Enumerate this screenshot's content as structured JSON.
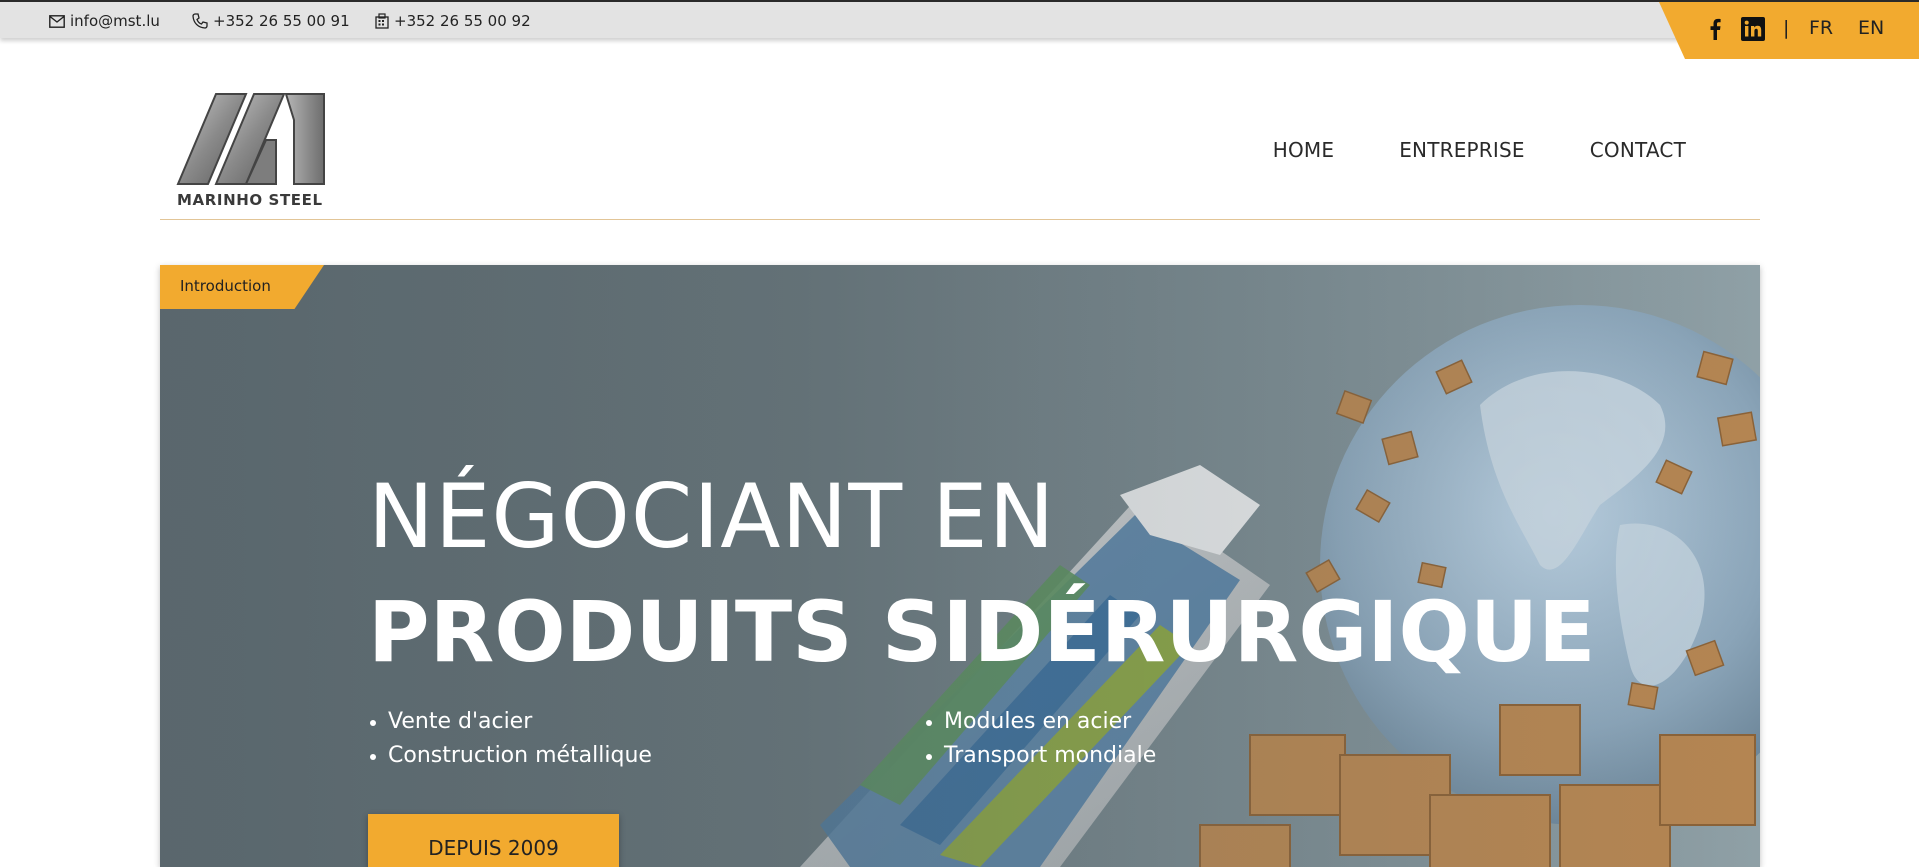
{
  "topbar": {
    "email": "info@mst.lu",
    "phone": "+352 26 55 00 91",
    "fax": "+352 26 55 00 92",
    "social": {
      "facebook_icon": "facebook-icon",
      "linkedin_icon": "linkedin-icon",
      "separator": "|",
      "lang_fr": "FR",
      "lang_en": "EN"
    }
  },
  "header": {
    "logo_text": "MARINHO STEEL",
    "nav": [
      "HOME",
      "ENTREPRISE",
      "CONTACT"
    ]
  },
  "hero": {
    "tag": "Introduction",
    "title_line1": "NÉGOCIANT EN",
    "title_line2": "PRODUITS SIDÉRURGIQUE",
    "list_left": [
      "Vente d'acier",
      "Construction métallique"
    ],
    "list_right": [
      "Modules en acier",
      "Transport mondiale"
    ],
    "cta": "DEPUIS 2009"
  },
  "colors": {
    "accent": "#f2aa2f",
    "topbar_bg": "#e3e3e3",
    "hero_overlay": "#67757a"
  }
}
